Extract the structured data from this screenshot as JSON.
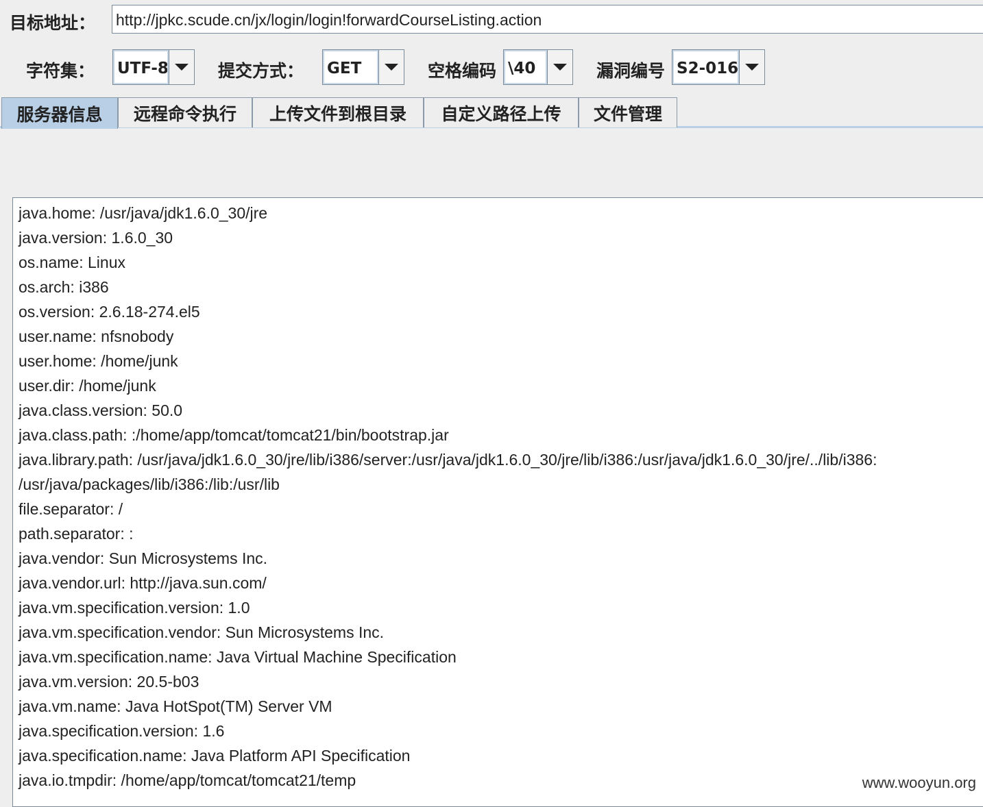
{
  "target": {
    "label": "目标地址：",
    "url": "http://jpkc.scude.cn/jx/login/login!forwardCourseListing.action"
  },
  "options": {
    "charset": {
      "label": "字符集：",
      "value": "UTF-8"
    },
    "method": {
      "label": "提交方式：",
      "value": "GET"
    },
    "space_encoding": {
      "label": "空格编码",
      "value": "\\40"
    },
    "vuln_id": {
      "label": "漏洞编号",
      "value": "S2-016"
    }
  },
  "tabs": [
    {
      "label": "服务器信息",
      "active": true
    },
    {
      "label": "远程命令执行",
      "active": false
    },
    {
      "label": "上传文件到根目录",
      "active": false
    },
    {
      "label": "自定义路径上传",
      "active": false
    },
    {
      "label": "文件管理",
      "active": false
    }
  ],
  "output_lines": [
    "java.home: /usr/java/jdk1.6.0_30/jre",
    "java.version: 1.6.0_30",
    "os.name: Linux",
    "os.arch: i386",
    "os.version: 2.6.18-274.el5",
    "user.name: nfsnobody",
    "user.home: /home/junk",
    "user.dir: /home/junk",
    "java.class.version: 50.0",
    "java.class.path: :/home/app/tomcat/tomcat21/bin/bootstrap.jar",
    "java.library.path: /usr/java/jdk1.6.0_30/jre/lib/i386/server:/usr/java/jdk1.6.0_30/jre/lib/i386:/usr/java/jdk1.6.0_30/jre/../lib/i386:",
    "/usr/java/packages/lib/i386:/lib:/usr/lib",
    "file.separator: /",
    "path.separator: :",
    "java.vendor: Sun Microsystems Inc.",
    "java.vendor.url: http://java.sun.com/",
    "java.vm.specification.version: 1.0",
    "java.vm.specification.vendor: Sun Microsystems Inc.",
    "java.vm.specification.name: Java Virtual Machine Specification",
    "java.vm.version: 20.5-b03",
    "java.vm.name: Java HotSpot(TM) Server VM",
    "java.specification.version: 1.6",
    "java.specification.name: Java Platform API Specification",
    "java.io.tmpdir: /home/app/tomcat/tomcat21/temp"
  ],
  "watermark": "www.wooyun.org",
  "colors": {
    "active_tab": "#b8cfe5",
    "window_bg": "#eeeeee",
    "border": "#7a8a99"
  }
}
